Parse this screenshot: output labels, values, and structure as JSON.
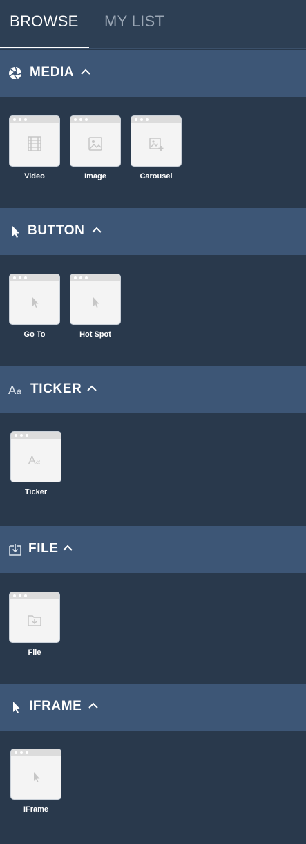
{
  "tabs": [
    {
      "label": "BROWSE",
      "active": true
    },
    {
      "label": "MY LIST",
      "active": false
    }
  ],
  "sections": [
    {
      "title": "MEDIA",
      "icon": "shutter-icon",
      "items": [
        {
          "label": "Video",
          "icon": "film-icon"
        },
        {
          "label": "Image",
          "icon": "image-icon"
        },
        {
          "label": "Carousel",
          "icon": "image-plus-icon"
        }
      ]
    },
    {
      "title": "BUTTON",
      "icon": "cursor-icon",
      "items": [
        {
          "label": "Go To",
          "icon": "cursor-icon"
        },
        {
          "label": "Hot Spot",
          "icon": "cursor-icon"
        }
      ]
    },
    {
      "title": "TICKER",
      "icon": "font-icon",
      "items": [
        {
          "label": "Ticker",
          "icon": "font-icon"
        }
      ]
    },
    {
      "title": "FILE",
      "icon": "file-download-icon",
      "items": [
        {
          "label": "File",
          "icon": "folder-download-icon"
        }
      ]
    },
    {
      "title": "IFRAME",
      "icon": "cursor-icon",
      "items": [
        {
          "label": "IFrame",
          "icon": "cursor-icon"
        }
      ]
    }
  ],
  "colors": {
    "panel_bg": "#29394c",
    "header_bg": "#3d5676",
    "tab_bar_bg": "#2d3f54",
    "card_bg": "#f4f4f4"
  }
}
